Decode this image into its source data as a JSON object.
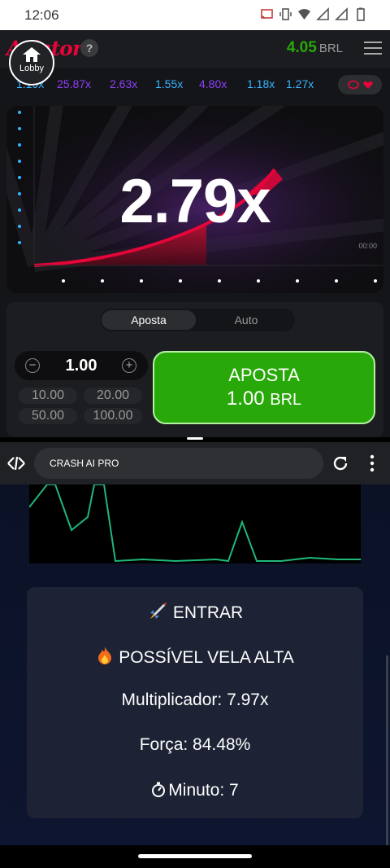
{
  "status": {
    "time": "12:06"
  },
  "game": {
    "logo": "Aviator",
    "help": "?",
    "balance": {
      "amount": "4.05",
      "currency": "BRL"
    },
    "lobby_label": "Lobby",
    "history": [
      "1.19x",
      "25.87x",
      "2.63x",
      "1.55x",
      "4.80x",
      "1.18x",
      "1.27x"
    ],
    "multiplier": "2.79x",
    "timer": "00:00",
    "tabs": [
      "Aposta",
      "Auto"
    ],
    "stake": "1.00",
    "stepper_minus": "−",
    "stepper_plus": "+",
    "quick_amounts": [
      "10.00",
      "20.00",
      "50.00",
      "100.00"
    ],
    "bet_button": {
      "label": "APOSTA",
      "amount": "1.00",
      "currency": "BRL"
    }
  },
  "browser": {
    "address": "CRASH AI PRO"
  },
  "signal": {
    "enter": "ENTRAR",
    "high_candle": "POSSÍVEL VELA ALTA",
    "multiplier": "Multiplicador: 7.97x",
    "strength": "Força: 84.48%",
    "minute": "Minuto: 7"
  },
  "colors": {
    "brand_red": "#e50539",
    "win_green": "#28a909",
    "history_blue": "#34b4ff",
    "history_purple": "#913ef8"
  }
}
